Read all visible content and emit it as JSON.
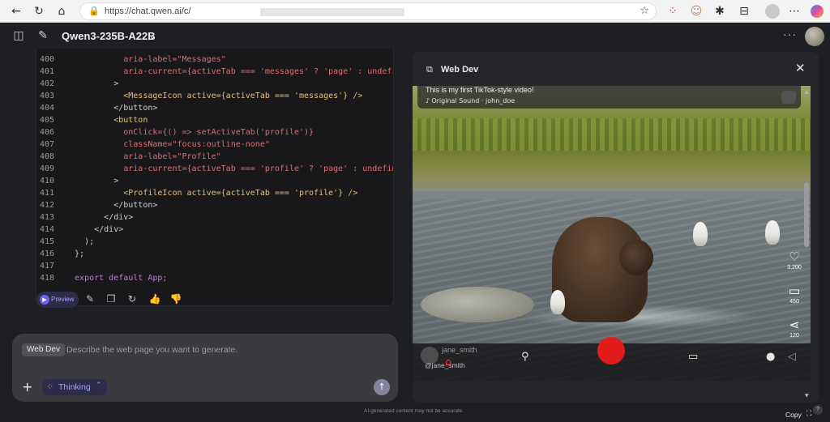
{
  "browser": {
    "url": "https://chat.qwen.ai/c/",
    "back_icon": "arrow-left-icon",
    "refresh_icon": "refresh-icon",
    "home_icon": "home-icon"
  },
  "header": {
    "model_name": "Qwen3-235B-A22B",
    "more": "···"
  },
  "code": {
    "lines": [
      {
        "n": "400",
        "src": "            aria-label=\"Messages\""
      },
      {
        "n": "401",
        "src": "            aria-current={activeTab === 'messages' ? 'page' : undefin"
      },
      {
        "n": "402",
        "src": "          >"
      },
      {
        "n": "403",
        "src": "            <MessageIcon active={activeTab === 'messages'} />"
      },
      {
        "n": "404",
        "src": "          </button>"
      },
      {
        "n": "405",
        "src": "          <button"
      },
      {
        "n": "406",
        "src": "            onClick={() => setActiveTab('profile')}"
      },
      {
        "n": "407",
        "src": "            className=\"focus:outline-none\""
      },
      {
        "n": "408",
        "src": "            aria-label=\"Profile\""
      },
      {
        "n": "409",
        "src": "            aria-current={activeTab === 'profile' ? 'page' : undefine"
      },
      {
        "n": "410",
        "src": "          >"
      },
      {
        "n": "411",
        "src": "            <ProfileIcon active={activeTab === 'profile'} />"
      },
      {
        "n": "412",
        "src": "          </button>"
      },
      {
        "n": "413",
        "src": "        </div>"
      },
      {
        "n": "414",
        "src": "      </div>"
      },
      {
        "n": "415",
        "src": "    );"
      },
      {
        "n": "416",
        "src": "  };"
      },
      {
        "n": "417",
        "src": ""
      },
      {
        "n": "418",
        "src": "  export default App;"
      }
    ]
  },
  "actions": {
    "preview_label": "Preview"
  },
  "input": {
    "tag": "Web Dev",
    "placeholder": "Describe the web page you want to generate.",
    "thinking_label": "Thinking"
  },
  "panel": {
    "title": "Web Dev",
    "video": {
      "caption": "This is my first TikTok-style video!",
      "sound": "Original Sound · john_doe",
      "likes": "3,200",
      "comments": "450",
      "shares": "120",
      "overlay_user": "jane_smith",
      "handle": "@jane_smith"
    },
    "copy_label": "Copy"
  },
  "footer": {
    "disclaimer": "AI-generated content may not be accurate.",
    "help": "?"
  }
}
